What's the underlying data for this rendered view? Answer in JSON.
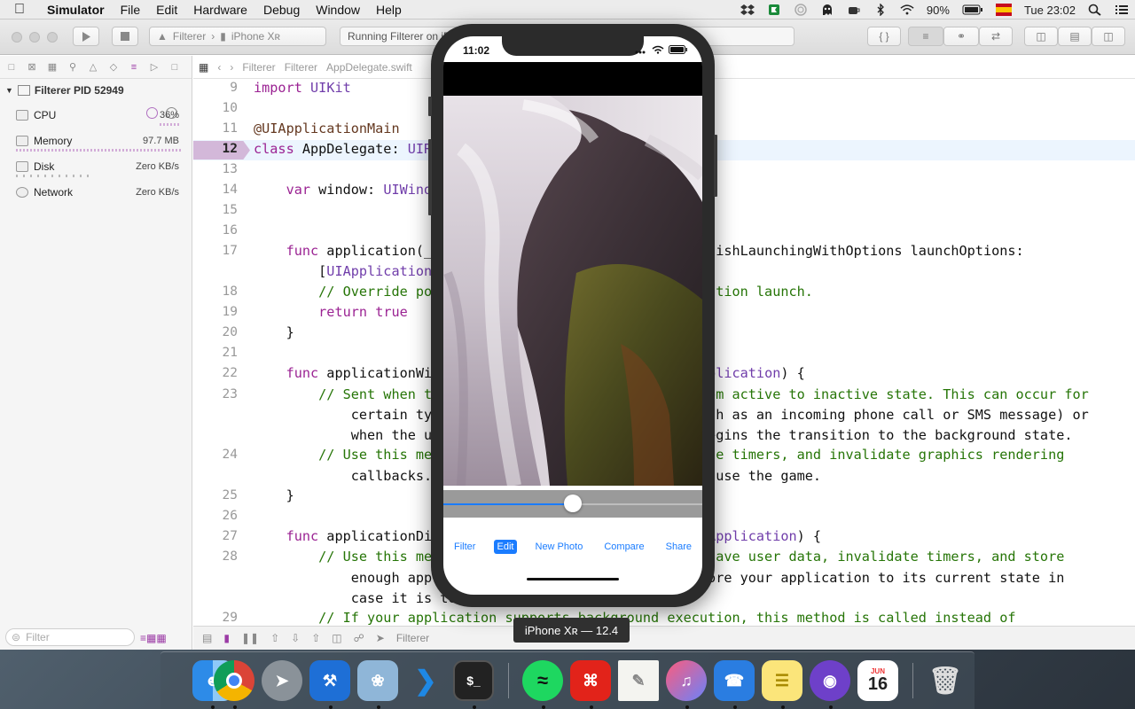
{
  "menubar": {
    "app_name": "Simulator",
    "items": [
      "File",
      "Edit",
      "Hardware",
      "Debug",
      "Window",
      "Help"
    ],
    "battery": "90%",
    "clock": "Tue 23:02"
  },
  "toolbar": {
    "scheme_target": "Filterer",
    "scheme_device": "iPhone Xʀ",
    "activity": "Running Filterer on iPhone Xʀ"
  },
  "navigator": {
    "process": "Filterer PID 52949",
    "gauges": [
      {
        "label": "CPU",
        "value": "36%"
      },
      {
        "label": "Memory",
        "value": "97.7 MB"
      },
      {
        "label": "Disk",
        "value": "Zero KB/s"
      },
      {
        "label": "Network",
        "value": "Zero KB/s"
      }
    ],
    "filter_placeholder": "Filter"
  },
  "editor": {
    "jumpbar": [
      "Filterer",
      "Filterer",
      "AppDelegate.swift"
    ],
    "current_line": "12",
    "lines": [
      {
        "n": "9",
        "text": "import UIKit"
      },
      {
        "n": "10",
        "text": ""
      },
      {
        "n": "11",
        "text": "@UIApplicationMain"
      },
      {
        "n": "12",
        "text": "class AppDelegate: UIResponder, UIApplicationDelegate {"
      },
      {
        "n": "13",
        "text": ""
      },
      {
        "n": "14",
        "text": "    var window: UIWindow?"
      },
      {
        "n": "15",
        "text": ""
      },
      {
        "n": "16",
        "text": ""
      },
      {
        "n": "17",
        "text": "    func application(_ application: UIApplication, didFinishLaunchingWithOptions launchOptions:"
      },
      {
        "n": "",
        "text": "        [UIApplication.LaunchOptionsKey: Any]?) -> Bool {"
      },
      {
        "n": "18",
        "text": "        // Override point for customization after application launch."
      },
      {
        "n": "19",
        "text": "        return true"
      },
      {
        "n": "20",
        "text": "    }"
      },
      {
        "n": "21",
        "text": ""
      },
      {
        "n": "22",
        "text": "    func applicationWillResignActive(_ application: UIApplication) {"
      },
      {
        "n": "23",
        "text": "        // Sent when the application is about to move from active to inactive state. This can occur for"
      },
      {
        "n": "",
        "text": "            certain types of temporary interruptions (such as an incoming phone call or SMS message) or"
      },
      {
        "n": "",
        "text": "            when the user quits the application and it begins the transition to the background state."
      },
      {
        "n": "24",
        "text": "        // Use this method to pause ongoing tasks, disable timers, and invalidate graphics rendering"
      },
      {
        "n": "",
        "text": "            callbacks. Games should use this method to pause the game."
      },
      {
        "n": "25",
        "text": "    }"
      },
      {
        "n": "26",
        "text": ""
      },
      {
        "n": "27",
        "text": "    func applicationDidEnterBackground(_ application: UIApplication) {"
      },
      {
        "n": "28",
        "text": "        // Use this method to release shared resources, save user data, invalidate timers, and store"
      },
      {
        "n": "",
        "text": "            enough application state information to restore your application to its current state in"
      },
      {
        "n": "",
        "text": "            case it is terminated later."
      },
      {
        "n": "29",
        "text": "        // If your application supports background execution, this method is called instead of"
      }
    ],
    "debugbar_target": "Filterer"
  },
  "simulator": {
    "status_time": "11:02",
    "slider_value": 0.5,
    "tabs": [
      "Filter",
      "Edit",
      "New Photo",
      "Compare",
      "Share"
    ],
    "active_tab": "Edit",
    "label": "iPhone Xʀ — 12.4"
  },
  "dock": {
    "apps": [
      "Finder",
      "Chrome",
      "Launchpad",
      "Xcode",
      "Preview",
      "Visual Studio Code",
      "iTerm",
      "Spotify",
      "Adobe Acrobat",
      "TextEdit",
      "iTunes",
      "Simulator",
      "Notes",
      "GitHub Desktop",
      "Calendar",
      "Trash"
    ],
    "calendar_month": "JUN",
    "calendar_day": "16"
  }
}
